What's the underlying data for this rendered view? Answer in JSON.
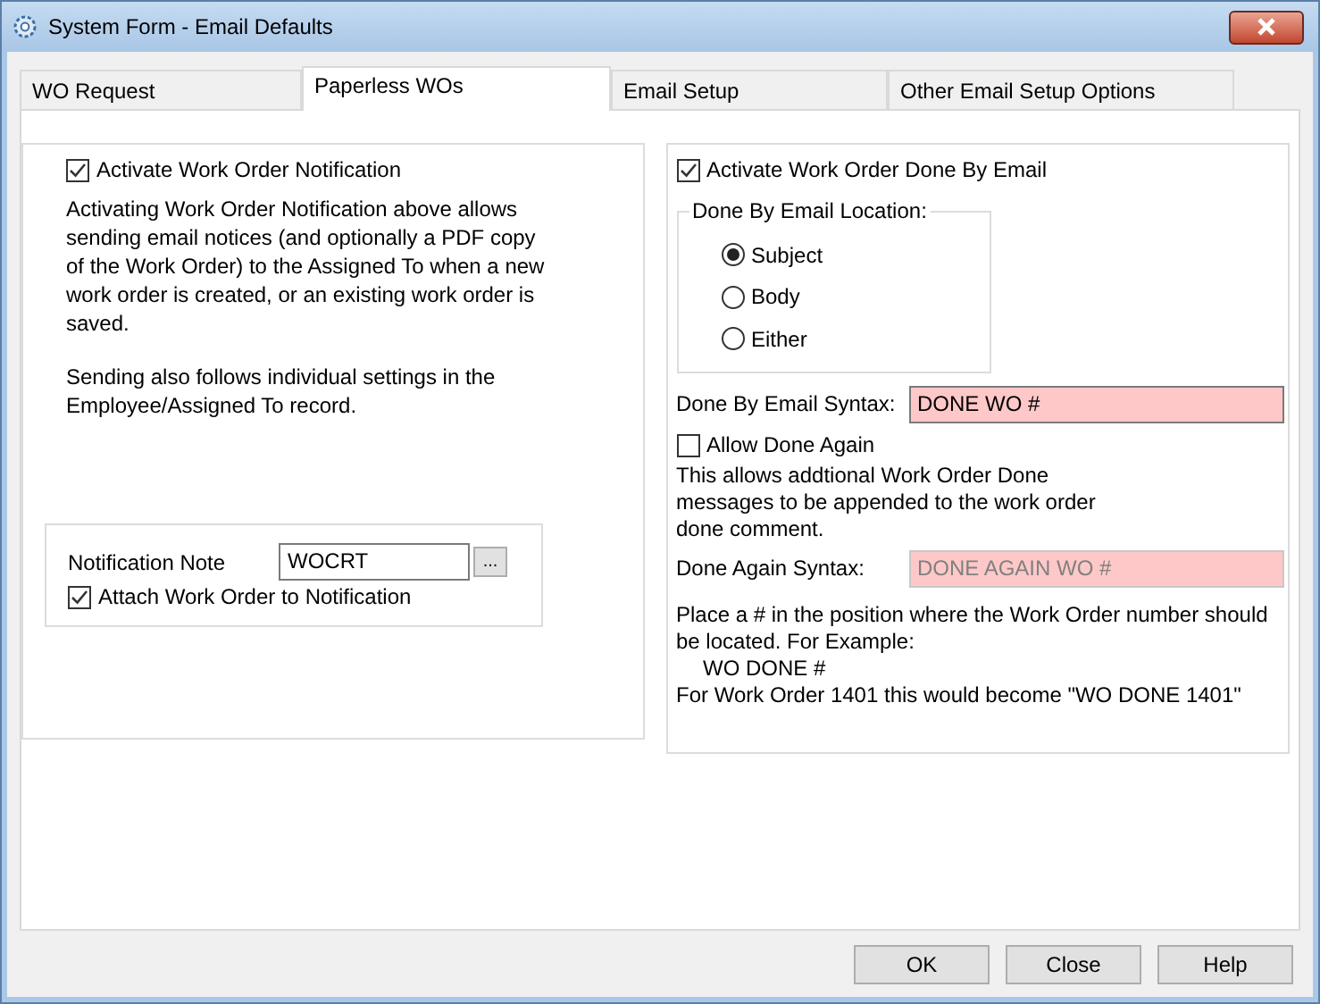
{
  "window": {
    "title": "System Form - Email Defaults"
  },
  "tabs": [
    {
      "label": "WO Request",
      "selected": false
    },
    {
      "label": "Paperless WOs",
      "selected": true
    },
    {
      "label": "Email Setup",
      "selected": false
    },
    {
      "label": "Other Email Setup Options",
      "selected": false
    }
  ],
  "notification": {
    "activate": {
      "label": "Activate Work Order Notification",
      "checked": true
    },
    "description": [
      "Activating Work Order Notification above allows sending email notices (and optionally a PDF copy of the Work Order) to the Assigned To when a new work order is created, or an existing work order is saved.",
      "Sending also follows individual settings in the Employee/Assigned To record."
    ],
    "note": {
      "label": "Notification Note",
      "value": "WOCRT",
      "browse": "..."
    },
    "attach": {
      "label": "Attach Work Order to Notification",
      "checked": true
    }
  },
  "done_by_email": {
    "activate": {
      "label": "Activate Work Order Done By Email",
      "checked": true
    },
    "location": {
      "title": "Done By Email Location:",
      "options": [
        {
          "label": "Subject",
          "selected": true
        },
        {
          "label": "Body",
          "selected": false
        },
        {
          "label": "Either",
          "selected": false
        }
      ]
    },
    "syntax": {
      "label": "Done By Email Syntax:",
      "value": "DONE WO #",
      "disabled": false
    },
    "allow_again": {
      "label": "Allow Done Again",
      "checked": false
    },
    "allow_again_note": "This allows addtional Work Order Done messages to be appended to the work order done comment.",
    "again_syntax": {
      "label": "Done Again Syntax:",
      "value": "DONE AGAIN WO #",
      "disabled": true
    },
    "help": [
      "Place a # in the position where the Work Order number should be located. For Example:",
      "WO DONE #",
      "For Work Order 1401 this would become \"WO DONE 1401\""
    ]
  },
  "buttons": [
    "OK",
    "Close",
    "Help"
  ]
}
